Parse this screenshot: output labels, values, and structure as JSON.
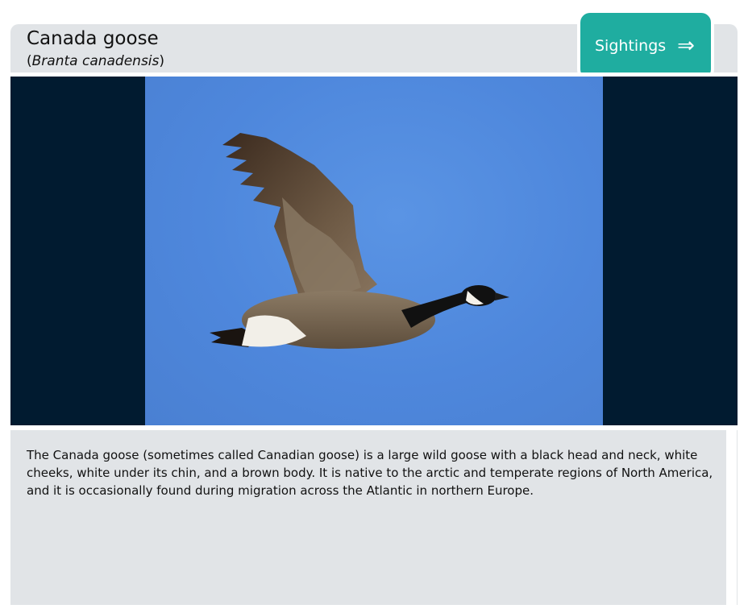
{
  "bird": {
    "common_name": "Canada goose",
    "scientific_name": "Branta canadensis",
    "open_paren": "(",
    "close_paren": ")"
  },
  "actions": {
    "sightings_label": "Sightings",
    "sightings_icon": "right-double-arrow-icon"
  },
  "photo": {
    "subject": "Canada goose in flight"
  },
  "description": "The Canada goose (sometimes called Canadian goose) is a large wild goose with a black head and neck, white cheeks, white under its chin, and a brown body. It is native to the arctic and temperate regions of North America, and it is occasionally found during migration across the Atlantic in northern Europe.",
  "colors": {
    "accent": "#1fada0",
    "panel": "#e1e4e7",
    "media_bg": "#011b30",
    "sky": "#4e87dc"
  }
}
